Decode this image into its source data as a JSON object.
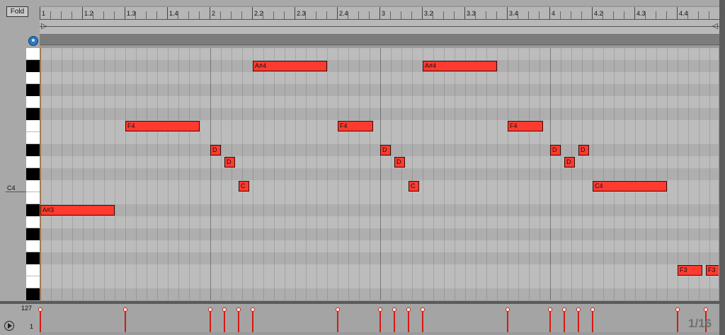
{
  "header": {
    "fold_label": "Fold"
  },
  "ruler": {
    "labels": [
      "1",
      "1.2",
      "1.3",
      "1.4",
      "2",
      "2.2",
      "2.3",
      "2.4",
      "3",
      "3.2",
      "3.3",
      "3.4",
      "4",
      "4.2",
      "4.3",
      "4.4"
    ]
  },
  "keyboard": {
    "c4_label": "C4"
  },
  "notes": [
    {
      "pitch": "A#3",
      "start": 0.0,
      "length": 0.4375,
      "row": 13
    },
    {
      "pitch": "F4",
      "start": 0.5,
      "length": 0.4375,
      "row": 6
    },
    {
      "pitch": "D",
      "start": 1.0,
      "length": 0.0625,
      "row": 8
    },
    {
      "pitch": "D",
      "start": 1.0833,
      "length": 0.0625,
      "row": 9
    },
    {
      "pitch": "C",
      "start": 1.1667,
      "length": 0.0625,
      "row": 11
    },
    {
      "pitch": "A#4",
      "start": 1.25,
      "length": 0.4375,
      "row": 1
    },
    {
      "pitch": "F4",
      "start": 1.75,
      "length": 0.2083,
      "row": 6
    },
    {
      "pitch": "D",
      "start": 2.0,
      "length": 0.0625,
      "row": 8
    },
    {
      "pitch": "D",
      "start": 2.0833,
      "length": 0.0625,
      "row": 9
    },
    {
      "pitch": "C",
      "start": 2.1667,
      "length": 0.0625,
      "row": 11
    },
    {
      "pitch": "A#4",
      "start": 2.25,
      "length": 0.4375,
      "row": 1
    },
    {
      "pitch": "F4",
      "start": 2.75,
      "length": 0.2083,
      "row": 6
    },
    {
      "pitch": "D",
      "start": 3.0,
      "length": 0.0625,
      "row": 8
    },
    {
      "pitch": "D",
      "start": 3.0833,
      "length": 0.0625,
      "row": 9
    },
    {
      "pitch": "D",
      "start": 3.1667,
      "length": 0.0625,
      "row": 8
    },
    {
      "pitch": "C4",
      "start": 3.25,
      "length": 0.4375,
      "row": 11
    },
    {
      "pitch": "F3",
      "start": 3.75,
      "length": 0.1458,
      "row": 18
    },
    {
      "pitch": "F3",
      "start": 3.9167,
      "length": 0.0833,
      "row": 18
    }
  ],
  "velocity": {
    "max_label": "127",
    "min_label": "1"
  },
  "footer": {
    "quantize_label": "1/16"
  },
  "colors": {
    "note": "#ff3b30",
    "velocity_stem": "#d71a10",
    "loop_brace": "#e07a20"
  },
  "icons": [
    "lock-icon",
    "play-icon"
  ]
}
